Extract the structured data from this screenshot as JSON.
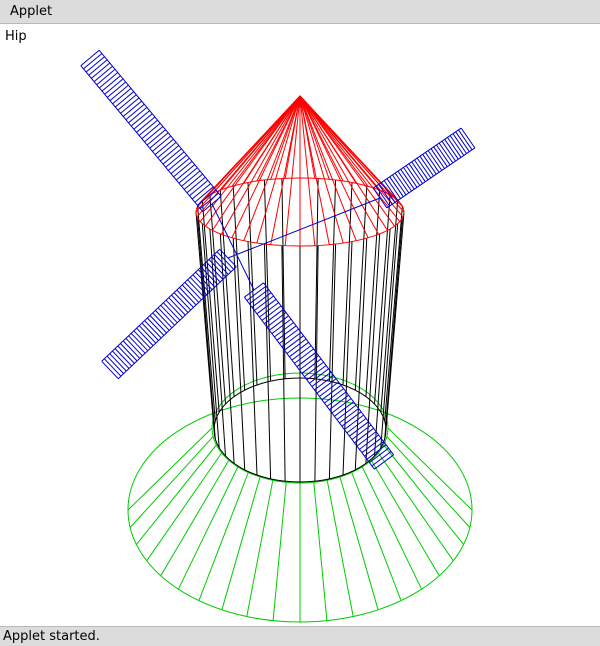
{
  "window": {
    "menu_title": "Applet"
  },
  "applet": {
    "label": "Hip"
  },
  "status": {
    "text": "Applet started."
  },
  "colors": {
    "roof": "#ff0000",
    "tower": "#000000",
    "base": "#00cc00",
    "blades": "#0000cc"
  }
}
